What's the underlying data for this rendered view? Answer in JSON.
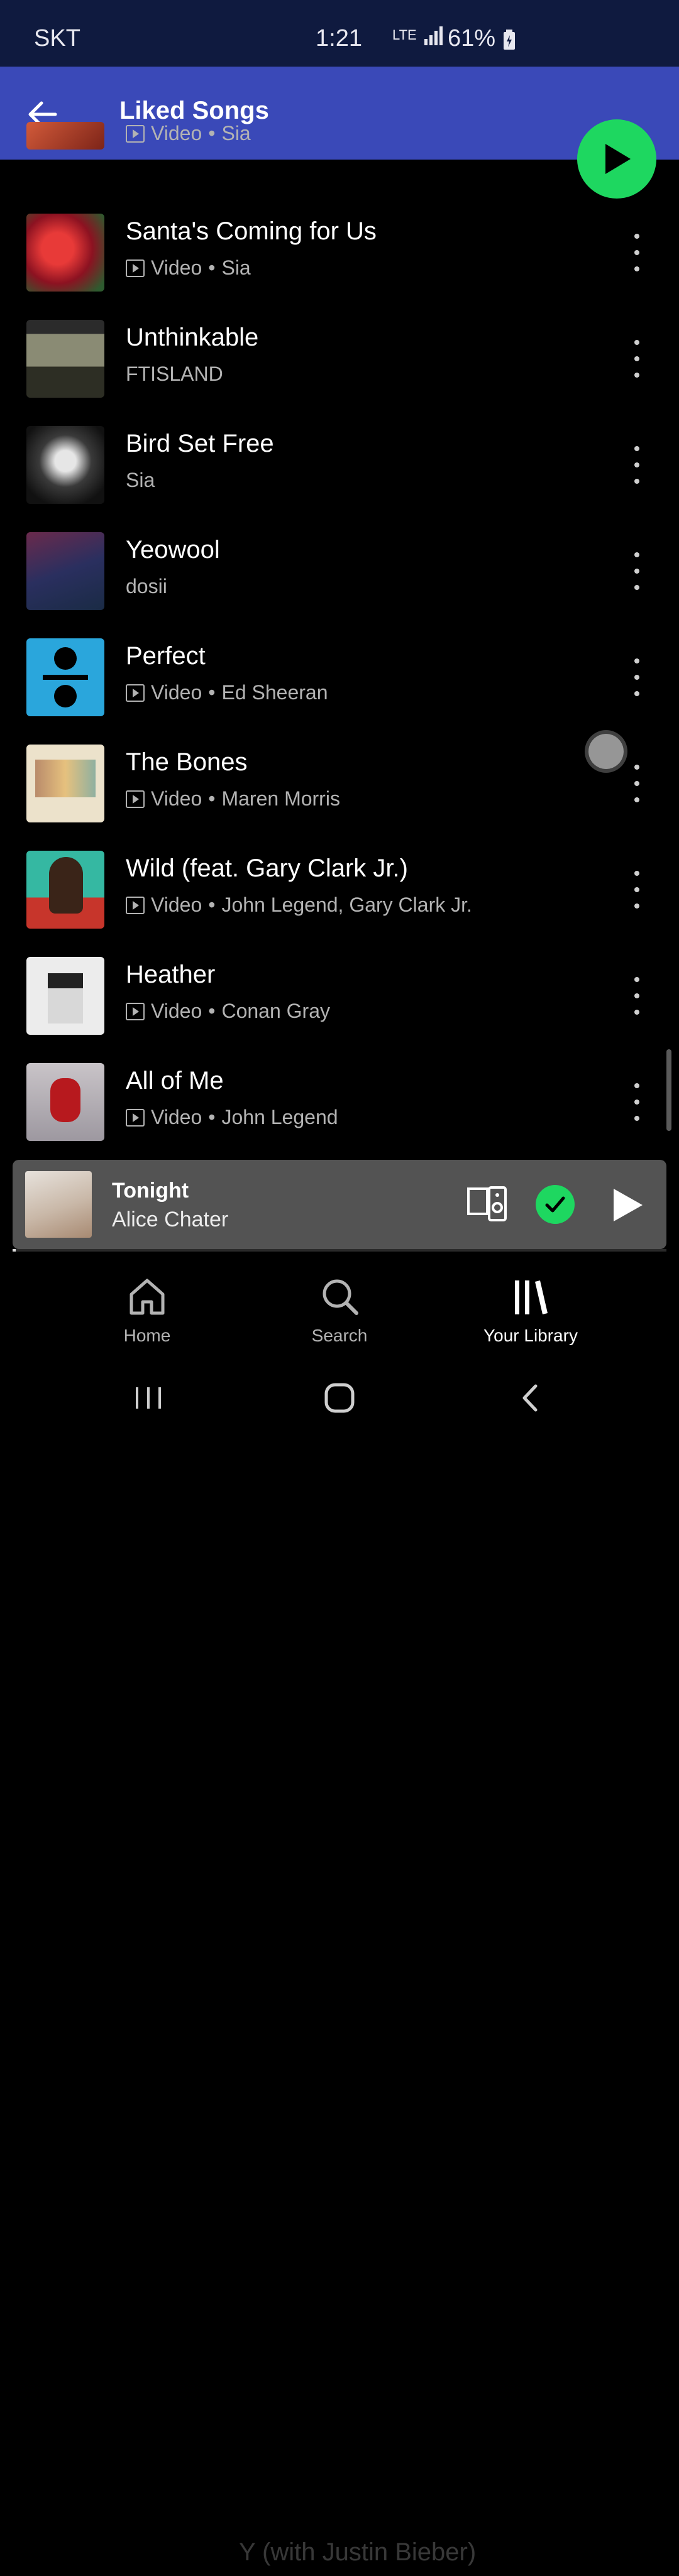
{
  "status_bar": {
    "carrier": "SKT",
    "time": "1:21",
    "network": "LTE",
    "battery": "61%"
  },
  "header": {
    "title": "Liked Songs"
  },
  "songs": [
    {
      "title": "",
      "type": "Video",
      "artist": "Sia",
      "art_color": "#c94a36"
    },
    {
      "title": "Santa's Coming for Us",
      "type": "Video",
      "artist": "Sia",
      "art_color": "#b21e2b"
    },
    {
      "title": "Unthinkable",
      "type": "",
      "artist": "FTISLAND",
      "art_color": "#6b6d5c"
    },
    {
      "title": "Bird Set Free",
      "type": "",
      "artist": "Sia",
      "art_color": "#2b2b2b"
    },
    {
      "title": "Yeowool",
      "type": "",
      "artist": "dosii",
      "art_color": "#3a3460"
    },
    {
      "title": "Perfect",
      "type": "Video",
      "artist": "Ed Sheeran",
      "art_color": "#2aa6dc"
    },
    {
      "title": "The Bones",
      "type": "Video",
      "artist": "Maren Morris",
      "art_color": "#e9dcc2"
    },
    {
      "title": "Wild (feat. Gary Clark Jr.)",
      "type": "Video",
      "artist": "John Legend, Gary Clark Jr.",
      "art_color": "#2fb39e"
    },
    {
      "title": "Heather",
      "type": "Video",
      "artist": "Conan Gray",
      "art_color": "#e4e4e4"
    },
    {
      "title": "All of Me",
      "type": "Video",
      "artist": "John Legend",
      "art_color": "#9b9aa3"
    }
  ],
  "ghost_row_text": "Y (with Justin Bieber)",
  "mini_player": {
    "title": "Tonight",
    "artist": "Alice Chater",
    "progress": 0.005
  },
  "bottom_nav": [
    {
      "label": "Home",
      "icon": "home-icon",
      "active": false
    },
    {
      "label": "Search",
      "icon": "search-icon",
      "active": false
    },
    {
      "label": "Your Library",
      "icon": "library-icon",
      "active": true
    }
  ],
  "colors": {
    "accent": "#1ed760",
    "header": "#3a49b8",
    "status_bar": "#0f1a3f",
    "mini_player": "#535353"
  }
}
